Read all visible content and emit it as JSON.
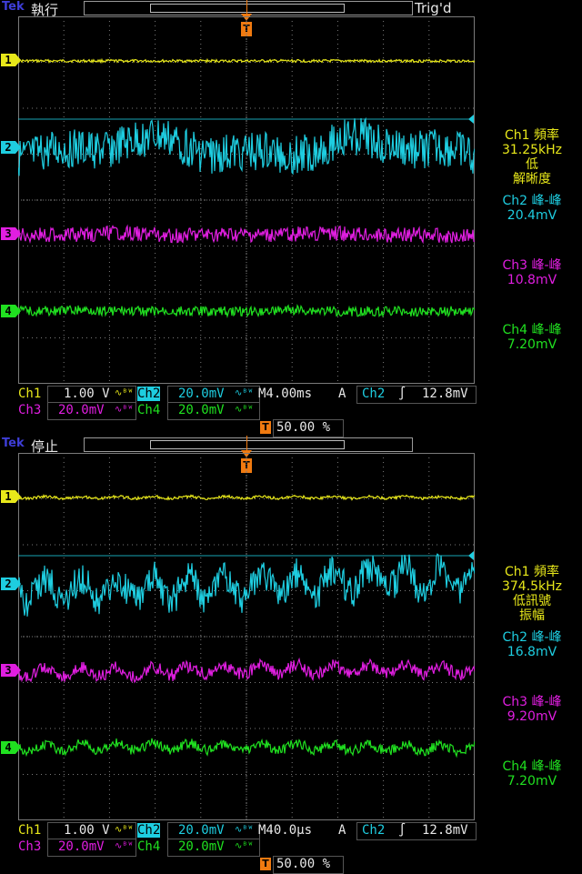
{
  "brand": "Tek",
  "panels": [
    {
      "status": "執行",
      "trig_label": "Trig'd",
      "trigger_marker": "T",
      "channel_markers": [
        "1",
        "2",
        "3",
        "4"
      ],
      "measurements": [
        {
          "lines": [
            "Ch1 頻率",
            "31.25kHz",
            "低",
            "解晰度"
          ],
          "color": "#e8e81a"
        },
        {
          "lines": [
            "Ch2 峰-峰",
            "20.4mV"
          ],
          "color": "#1ecde0"
        },
        {
          "lines": [
            "Ch3 峰-峰",
            "10.8mV"
          ],
          "color": "#e01ee0"
        },
        {
          "lines": [
            "Ch4 峰-峰",
            "7.20mV"
          ],
          "color": "#20e020"
        }
      ],
      "bottom": {
        "ch1": "Ch1",
        "ch1_scale": "1.00 V",
        "ch2": "Ch2",
        "ch2_scale": "20.0mV",
        "ch3": "Ch3",
        "ch3_scale": "20.0mV",
        "ch4": "Ch4",
        "ch4_scale": "20.0mV",
        "bw_symbol": "∿ᴮᵂ",
        "timebase": "M4.00ms",
        "trig_mode": "A",
        "trig_source": "Ch2",
        "trig_slope": "∫",
        "trig_level": "12.8mV",
        "position": "50.00 %"
      }
    },
    {
      "status": "停止",
      "trig_label": "",
      "trigger_marker": "T",
      "channel_markers": [
        "1",
        "2",
        "3",
        "4"
      ],
      "measurements": [
        {
          "lines": [
            "Ch1 頻率",
            "374.5kHz",
            "低訊號",
            "振幅"
          ],
          "color": "#e8e81a"
        },
        {
          "lines": [
            "Ch2 峰-峰",
            "16.8mV"
          ],
          "color": "#1ecde0"
        },
        {
          "lines": [
            "Ch3 峰-峰",
            "9.20mV"
          ],
          "color": "#e01ee0"
        },
        {
          "lines": [
            "Ch4 峰-峰",
            "7.20mV"
          ],
          "color": "#20e020"
        }
      ],
      "bottom": {
        "ch1": "Ch1",
        "ch1_scale": "1.00 V",
        "ch2": "Ch2",
        "ch2_scale": "20.0mV",
        "ch3": "Ch3",
        "ch3_scale": "20.0mV",
        "ch4": "Ch4",
        "ch4_scale": "20.0mV",
        "bw_symbol": "∿ᴮᵂ",
        "timebase": "M40.0µs",
        "trig_mode": "A",
        "trig_source": "Ch2",
        "trig_slope": "∫",
        "trig_level": "12.8mV",
        "position": "50.00 %"
      }
    }
  ],
  "colors": {
    "ch1": "#e8e81a",
    "ch2": "#1ecde0",
    "ch3": "#e01ee0",
    "ch4": "#20e020",
    "grid": "#7a7a7a",
    "trigger": "#f07a10"
  },
  "waveforms": {
    "top": {
      "ch1_pp_v": 0.02,
      "ch2_pp_mV": 20.4,
      "ch3_pp_mV": 10.8,
      "ch4_pp_mV": 7.2
    },
    "bottom": {
      "ch1_pp_v": 0.02,
      "ch2_pp_mV": 16.8,
      "ch3_pp_mV": 9.2,
      "ch4_pp_mV": 7.2
    }
  }
}
